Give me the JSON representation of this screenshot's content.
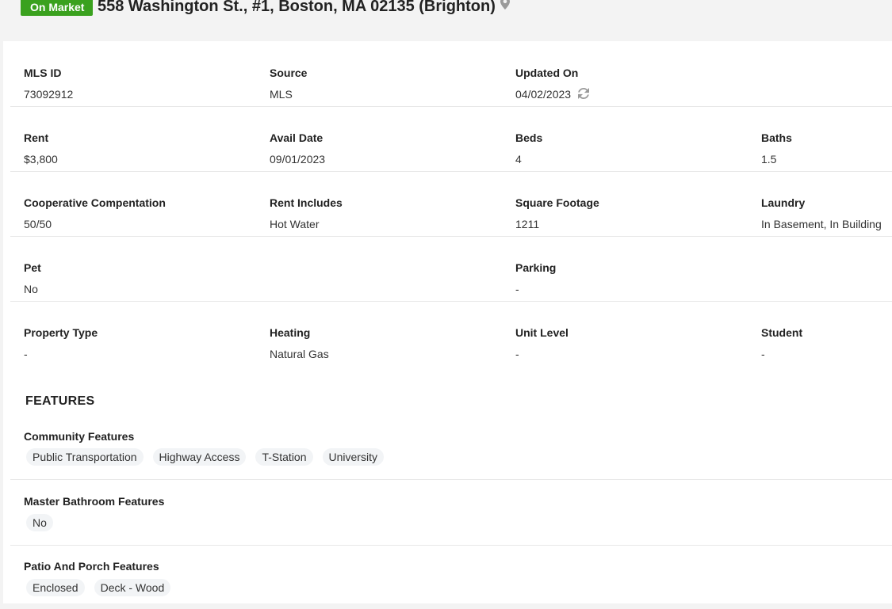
{
  "header": {
    "status": "On Market",
    "address": "558 Washington St., #1, Boston, MA 02135 (Brighton)",
    "pin_icon": "map-pin-icon"
  },
  "details": {
    "rows": [
      [
        {
          "label": "MLS ID",
          "value": "73092912"
        },
        {
          "label": "Source",
          "value": "MLS"
        },
        {
          "label": "Updated On",
          "value": "04/02/2023"
        }
      ],
      [
        {
          "label": "Rent",
          "value": "$3,800"
        },
        {
          "label": "Avail Date",
          "value": "09/01/2023"
        },
        {
          "label": "Beds",
          "value": "4"
        },
        {
          "label": "Baths",
          "value": "1.5"
        }
      ],
      [
        {
          "label": "Cooperative Compentation",
          "value": "50/50"
        },
        {
          "label": "Rent Includes",
          "value": "Hot Water"
        },
        {
          "label": "Square Footage",
          "value": "1211"
        },
        {
          "label": "Laundry",
          "value": "In Basement, In Building"
        }
      ],
      [
        {
          "label": "Pet",
          "value": "No"
        },
        {
          "label": "Parking",
          "value": "-"
        }
      ],
      [
        {
          "label": "Property Type",
          "value": "-"
        },
        {
          "label": "Heating",
          "value": "Natural Gas"
        },
        {
          "label": "Unit Level",
          "value": "-"
        },
        {
          "label": "Student",
          "value": "-"
        }
      ]
    ],
    "refresh_icon": "refresh-icon"
  },
  "features": {
    "heading": "FEATURES",
    "groups": [
      {
        "label": "Community Features",
        "tags": [
          "Public Transportation",
          "Highway Access",
          "T-Station",
          "University"
        ]
      },
      {
        "label": "Master Bathroom Features",
        "tags": [
          "No"
        ]
      },
      {
        "label": "Patio And Porch Features",
        "tags": [
          "Enclosed",
          "Deck - Wood"
        ]
      }
    ]
  },
  "colors": {
    "badge": "#3aa11e",
    "page_bg": "#f3f3f3",
    "divider": "#e8e8e8",
    "tag_bg": "#f2f4f6"
  }
}
